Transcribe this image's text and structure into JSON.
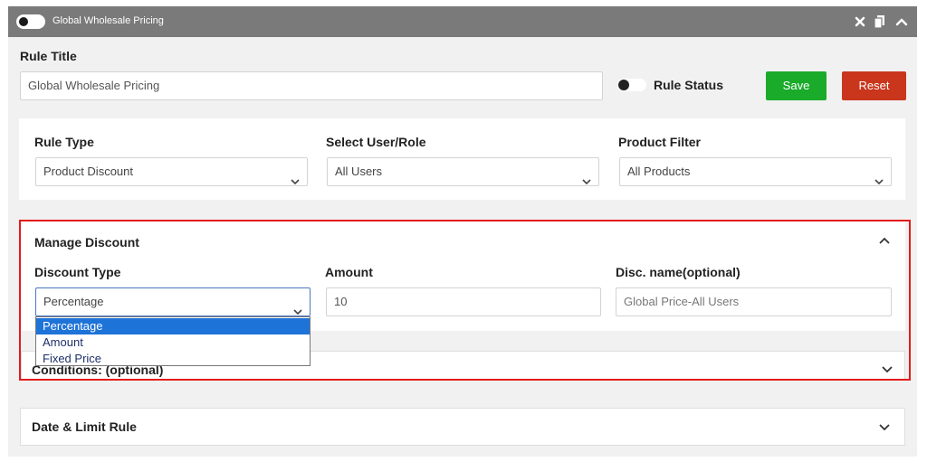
{
  "header": {
    "title": "Global Wholesale Pricing",
    "icons": [
      "close-icon",
      "copy-icon",
      "chevron-up-icon"
    ]
  },
  "rule_title": {
    "label": "Rule Title",
    "value": "Global Wholesale Pricing"
  },
  "rule_status": {
    "label": "Rule Status"
  },
  "actions": {
    "save_label": "Save",
    "save_color": "#1aab2a",
    "reset_label": "Reset",
    "reset_color": "#c9361c"
  },
  "rule_settings": {
    "rule_type": {
      "label": "Rule Type",
      "value": "Product Discount"
    },
    "user_role": {
      "label": "Select User/Role",
      "value": "All Users"
    },
    "product_filter": {
      "label": "Product Filter",
      "value": "All Products"
    }
  },
  "manage_discount": {
    "title": "Manage Discount",
    "discount_type": {
      "label": "Discount Type",
      "value": "Percentage",
      "options": [
        "Percentage",
        "Amount",
        "Fixed Price"
      ]
    },
    "amount": {
      "label": "Amount",
      "value": "10"
    },
    "disc_name": {
      "label": "Disc. name(optional)",
      "value": "Global Price-All Users"
    }
  },
  "conditions": {
    "title": "Conditions: (optional)"
  },
  "date_limit": {
    "title": "Date & Limit Rule"
  },
  "colors": {
    "highlight_border": "#e31b1b",
    "header_bg": "#7a7a7a",
    "option_selected": "#1e73d8"
  }
}
